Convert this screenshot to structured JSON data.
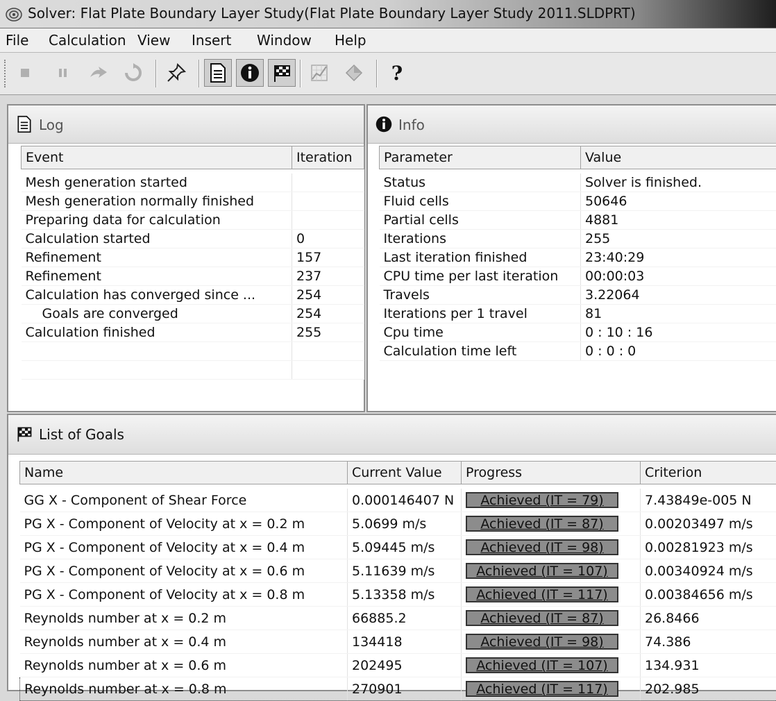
{
  "window": {
    "title": "Solver: Flat Plate Boundary Layer Study(Flat Plate Boundary Layer Study 2011.SLDPRT)"
  },
  "menu": [
    "File",
    "Calculation",
    "View",
    "Insert",
    "Window",
    "Help"
  ],
  "toolbar": {
    "buttons": [
      "stop-icon",
      "pause-icon",
      "step-icon",
      "refresh-icon",
      "pin-icon",
      "log-icon",
      "info-icon",
      "goals-icon",
      "plot-icon",
      "preview-icon",
      "help-icon"
    ],
    "help_glyph": "?"
  },
  "log": {
    "title": "Log",
    "columns": [
      "Event",
      "Iteration"
    ],
    "rows": [
      {
        "event": "Mesh generation started",
        "iteration": ""
      },
      {
        "event": "Mesh generation normally finished",
        "iteration": ""
      },
      {
        "event": "Preparing data for calculation",
        "iteration": ""
      },
      {
        "event": "Calculation started",
        "iteration": "0"
      },
      {
        "event": "Refinement",
        "iteration": "157"
      },
      {
        "event": "Refinement",
        "iteration": "237"
      },
      {
        "event": "Calculation has converged since ...",
        "iteration": "254"
      },
      {
        "event": "Goals are converged",
        "iteration": "254"
      },
      {
        "event": "Calculation finished",
        "iteration": "255"
      }
    ]
  },
  "info": {
    "title": "Info",
    "columns": [
      "Parameter",
      "Value"
    ],
    "rows": [
      {
        "parameter": "Status",
        "value": "Solver is finished."
      },
      {
        "parameter": "Fluid cells",
        "value": "50646"
      },
      {
        "parameter": "Partial cells",
        "value": "4881"
      },
      {
        "parameter": "Iterations",
        "value": "255"
      },
      {
        "parameter": "Last iteration finished",
        "value": "23:40:29"
      },
      {
        "parameter": "CPU time per last iteration",
        "value": "00:00:03"
      },
      {
        "parameter": "Travels",
        "value": "3.22064"
      },
      {
        "parameter": "Iterations per 1 travel",
        "value": "81"
      },
      {
        "parameter": "Cpu time",
        "value": "0 : 10 : 16"
      },
      {
        "parameter": "Calculation time left",
        "value": "0 : 0 : 0"
      }
    ]
  },
  "goals": {
    "title": "List of Goals",
    "columns": [
      "Name",
      "Current Value",
      "Progress",
      "Criterion"
    ],
    "rows": [
      {
        "name": "GG X - Component of Shear Force",
        "current": "0.000146407 N",
        "progress": "Achieved (IT = 79)",
        "progress_fraction": 1.0,
        "criterion": "7.43849e-005 N"
      },
      {
        "name": "PG X - Component of Velocity at x = 0.2 m",
        "current": "5.0699 m/s",
        "progress": "Achieved (IT = 87)",
        "progress_fraction": 1.0,
        "criterion": "0.00203497 m/s"
      },
      {
        "name": "PG X - Component of Velocity at x = 0.4 m",
        "current": "5.09445 m/s",
        "progress": "Achieved (IT = 98)",
        "progress_fraction": 1.0,
        "criterion": "0.00281923 m/s"
      },
      {
        "name": "PG X - Component of Velocity at x = 0.6 m",
        "current": "5.11639 m/s",
        "progress": "Achieved (IT = 107)",
        "progress_fraction": 1.0,
        "criterion": "0.00340924 m/s"
      },
      {
        "name": "PG X - Component of Velocity at x = 0.8 m",
        "current": "5.13358 m/s",
        "progress": "Achieved (IT = 117)",
        "progress_fraction": 1.0,
        "criterion": "0.00384656 m/s"
      },
      {
        "name": "Reynolds number at x = 0.2 m",
        "current": "66885.2",
        "progress": "Achieved (IT = 87)",
        "progress_fraction": 1.0,
        "criterion": "26.8466"
      },
      {
        "name": "Reynolds number at x = 0.4 m",
        "current": "134418",
        "progress": "Achieved (IT = 98)",
        "progress_fraction": 1.0,
        "criterion": "74.386"
      },
      {
        "name": "Reynolds number at x = 0.6 m",
        "current": "202495",
        "progress": "Achieved (IT = 107)",
        "progress_fraction": 1.0,
        "criterion": "134.931"
      },
      {
        "name": "Reynolds number at x = 0.8 m",
        "current": "270901",
        "progress": "Achieved (IT = 117)",
        "progress_fraction": 1.0,
        "criterion": "202.985"
      }
    ]
  }
}
